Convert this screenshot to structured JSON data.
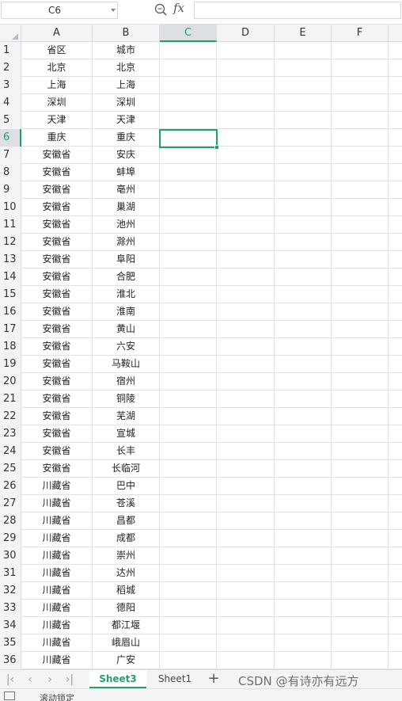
{
  "formula_bar": {
    "name_box": "C6",
    "fx": "fx",
    "formula": ""
  },
  "columns": [
    "A",
    "B",
    "C",
    "D",
    "E",
    "F"
  ],
  "selected_column": "C",
  "selected_row": 6,
  "rows": [
    {
      "n": "1",
      "a": "省区",
      "b": "城市"
    },
    {
      "n": "2",
      "a": "北京",
      "b": "北京"
    },
    {
      "n": "3",
      "a": "上海",
      "b": "上海"
    },
    {
      "n": "4",
      "a": "深圳",
      "b": "深圳"
    },
    {
      "n": "5",
      "a": "天津",
      "b": "天津"
    },
    {
      "n": "6",
      "a": "重庆",
      "b": "重庆"
    },
    {
      "n": "7",
      "a": "安徽省",
      "b": "安庆"
    },
    {
      "n": "8",
      "a": "安徽省",
      "b": "蚌埠"
    },
    {
      "n": "9",
      "a": "安徽省",
      "b": "亳州"
    },
    {
      "n": "10",
      "a": "安徽省",
      "b": "巢湖"
    },
    {
      "n": "11",
      "a": "安徽省",
      "b": "池州"
    },
    {
      "n": "12",
      "a": "安徽省",
      "b": "滁州"
    },
    {
      "n": "13",
      "a": "安徽省",
      "b": "阜阳"
    },
    {
      "n": "14",
      "a": "安徽省",
      "b": "合肥"
    },
    {
      "n": "15",
      "a": "安徽省",
      "b": "淮北"
    },
    {
      "n": "16",
      "a": "安徽省",
      "b": "淮南"
    },
    {
      "n": "17",
      "a": "安徽省",
      "b": "黄山"
    },
    {
      "n": "18",
      "a": "安徽省",
      "b": "六安"
    },
    {
      "n": "19",
      "a": "安徽省",
      "b": "马鞍山"
    },
    {
      "n": "20",
      "a": "安徽省",
      "b": "宿州"
    },
    {
      "n": "21",
      "a": "安徽省",
      "b": "铜陵"
    },
    {
      "n": "22",
      "a": "安徽省",
      "b": "芜湖"
    },
    {
      "n": "23",
      "a": "安徽省",
      "b": "宣城"
    },
    {
      "n": "24",
      "a": "安徽省",
      "b": "长丰"
    },
    {
      "n": "25",
      "a": "安徽省",
      "b": "长临河"
    },
    {
      "n": "26",
      "a": "川藏省",
      "b": "巴中"
    },
    {
      "n": "27",
      "a": "川藏省",
      "b": "苍溪"
    },
    {
      "n": "28",
      "a": "川藏省",
      "b": "昌都"
    },
    {
      "n": "29",
      "a": "川藏省",
      "b": "成都"
    },
    {
      "n": "30",
      "a": "川藏省",
      "b": "崇州"
    },
    {
      "n": "31",
      "a": "川藏省",
      "b": "达州"
    },
    {
      "n": "32",
      "a": "川藏省",
      "b": "稻城"
    },
    {
      "n": "33",
      "a": "川藏省",
      "b": "德阳"
    },
    {
      "n": "34",
      "a": "川藏省",
      "b": "都江堰"
    },
    {
      "n": "35",
      "a": "川藏省",
      "b": "峨眉山"
    },
    {
      "n": "36",
      "a": "川藏省",
      "b": "广安"
    }
  ],
  "sheets": {
    "active": "Sheet3",
    "other": "Sheet1",
    "add": "+"
  },
  "nav_glyphs": {
    "first": "|‹",
    "prev": "‹",
    "next": "›",
    "last": "›|"
  },
  "watermark": "CSDN @有诗亦有远方",
  "status": {
    "text": "滚动锁定"
  },
  "colors": {
    "accent": "#21a366",
    "header_bg": "#f3f4f6",
    "gridline": "#dfe1e5"
  }
}
